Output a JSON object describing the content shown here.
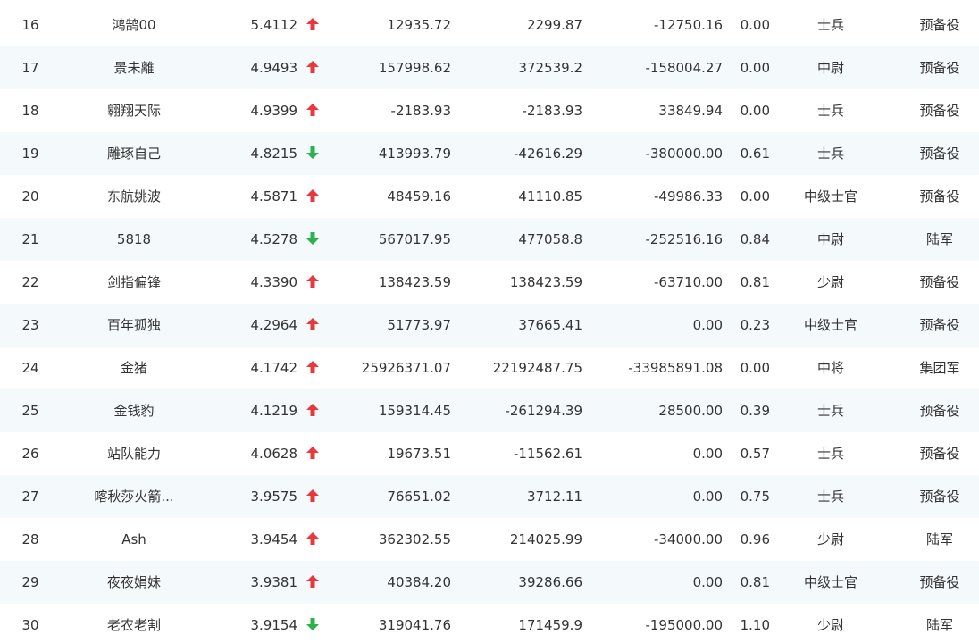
{
  "colors": {
    "up": "#e8383d",
    "down": "#2bb24c",
    "row_alt": "#f4f9fc",
    "text": "#333333"
  },
  "icons": {
    "up": "arrow-up-icon",
    "down": "arrow-down-icon"
  },
  "rows": [
    {
      "rank": "16",
      "name": "鸿鹄00",
      "score": "5.4112",
      "trend": "up",
      "v1": "12935.72",
      "v2": "2299.87",
      "v3": "-12750.16",
      "ratio": "0.00",
      "rank_title": "士兵",
      "unit": "预备役"
    },
    {
      "rank": "17",
      "name": "景未離",
      "score": "4.9493",
      "trend": "up",
      "v1": "157998.62",
      "v2": "372539.2",
      "v3": "-158004.27",
      "ratio": "0.00",
      "rank_title": "中尉",
      "unit": "预备役"
    },
    {
      "rank": "18",
      "name": "翱翔天际",
      "score": "4.9399",
      "trend": "up",
      "v1": "-2183.93",
      "v2": "-2183.93",
      "v3": "33849.94",
      "ratio": "0.00",
      "rank_title": "士兵",
      "unit": "预备役"
    },
    {
      "rank": "19",
      "name": "雕琢自己",
      "score": "4.8215",
      "trend": "down",
      "v1": "413993.79",
      "v2": "-42616.29",
      "v3": "-380000.00",
      "ratio": "0.61",
      "rank_title": "士兵",
      "unit": "预备役"
    },
    {
      "rank": "20",
      "name": "东航姚波",
      "score": "4.5871",
      "trend": "up",
      "v1": "48459.16",
      "v2": "41110.85",
      "v3": "-49986.33",
      "ratio": "0.00",
      "rank_title": "中级士官",
      "unit": "预备役"
    },
    {
      "rank": "21",
      "name": "5818",
      "score": "4.5278",
      "trend": "down",
      "v1": "567017.95",
      "v2": "477058.8",
      "v3": "-252516.16",
      "ratio": "0.84",
      "rank_title": "中尉",
      "unit": "陆军"
    },
    {
      "rank": "22",
      "name": "剑指偏锋",
      "score": "4.3390",
      "trend": "up",
      "v1": "138423.59",
      "v2": "138423.59",
      "v3": "-63710.00",
      "ratio": "0.81",
      "rank_title": "少尉",
      "unit": "预备役"
    },
    {
      "rank": "23",
      "name": "百年孤独",
      "score": "4.2964",
      "trend": "up",
      "v1": "51773.97",
      "v2": "37665.41",
      "v3": "0.00",
      "ratio": "0.23",
      "rank_title": "中级士官",
      "unit": "预备役"
    },
    {
      "rank": "24",
      "name": "金猪",
      "score": "4.1742",
      "trend": "up",
      "v1": "25926371.07",
      "v2": "22192487.75",
      "v3": "-33985891.08",
      "ratio": "0.00",
      "rank_title": "中将",
      "unit": "集团军"
    },
    {
      "rank": "25",
      "name": "金钱豹",
      "score": "4.1219",
      "trend": "up",
      "v1": "159314.45",
      "v2": "-261294.39",
      "v3": "28500.00",
      "ratio": "0.39",
      "rank_title": "士兵",
      "unit": "预备役"
    },
    {
      "rank": "26",
      "name": "站队能力",
      "score": "4.0628",
      "trend": "up",
      "v1": "19673.51",
      "v2": "-11562.61",
      "v3": "0.00",
      "ratio": "0.57",
      "rank_title": "士兵",
      "unit": "预备役"
    },
    {
      "rank": "27",
      "name": "喀秋莎火箭...",
      "score": "3.9575",
      "trend": "up",
      "v1": "76651.02",
      "v2": "3712.11",
      "v3": "0.00",
      "ratio": "0.75",
      "rank_title": "士兵",
      "unit": "预备役"
    },
    {
      "rank": "28",
      "name": "Ash",
      "score": "3.9454",
      "trend": "up",
      "v1": "362302.55",
      "v2": "214025.99",
      "v3": "-34000.00",
      "ratio": "0.96",
      "rank_title": "少尉",
      "unit": "陆军"
    },
    {
      "rank": "29",
      "name": "夜夜娟妹",
      "score": "3.9381",
      "trend": "up",
      "v1": "40384.20",
      "v2": "39286.66",
      "v3": "0.00",
      "ratio": "0.81",
      "rank_title": "中级士官",
      "unit": "预备役"
    },
    {
      "rank": "30",
      "name": "老农老割",
      "score": "3.9154",
      "trend": "down",
      "v1": "319041.76",
      "v2": "171459.9",
      "v3": "-195000.00",
      "ratio": "1.10",
      "rank_title": "少尉",
      "unit": "陆军"
    }
  ]
}
